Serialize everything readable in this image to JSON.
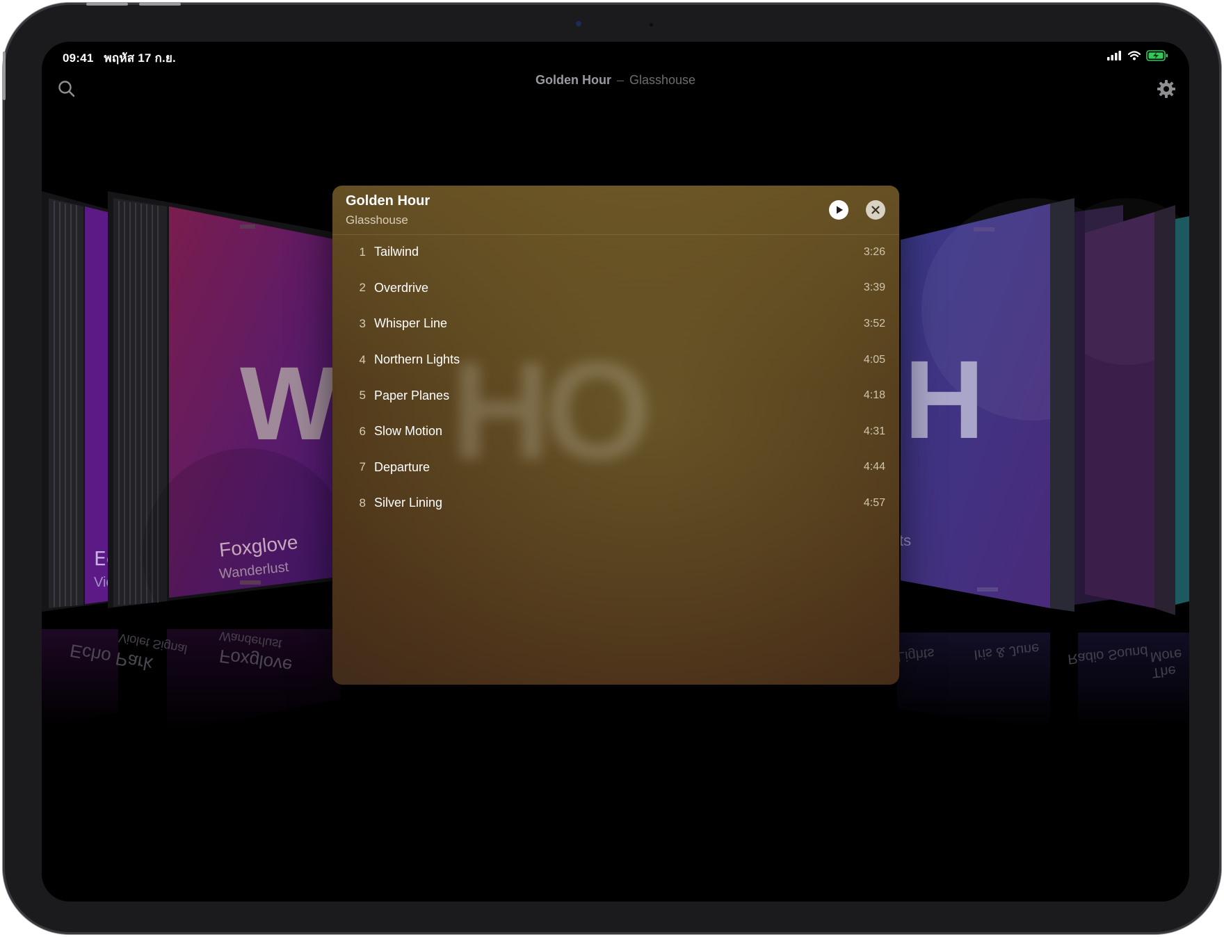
{
  "status_bar": {
    "time": "09:41",
    "date": "พฤหัส 17 ก.ย."
  },
  "topbar": {
    "album": "Golden Hour",
    "separator": "–",
    "artist": "Glasshouse"
  },
  "icons": {
    "search": "search-icon",
    "settings": "gear-icon",
    "play": "play-icon",
    "close": "close-icon"
  },
  "carousel": {
    "left": [
      {
        "title": "Echo Park",
        "subtitle": "Violet Signal",
        "visible_title": "Ec",
        "visible_subtitle": "Vio",
        "color": "#5b1a86"
      },
      {
        "title": "Foxglove",
        "subtitle": "Wanderlust",
        "big_letter": "W",
        "color": "#6c1d4d"
      }
    ],
    "right": [
      {
        "big_letter": "H",
        "visible_subtitle": "ts",
        "color": "#3d2f7a"
      },
      {
        "color": "#3b1e4a"
      },
      {
        "color": "#1d5a60"
      }
    ],
    "reflection_texts": [
      "Echo Park",
      "Violet Signal",
      "Foxglove",
      "Wanderlust",
      "Lights",
      "Iris & June",
      "Radio Sound",
      "The More"
    ]
  },
  "panel": {
    "title": "Golden Hour",
    "subtitle": "Glasshouse",
    "accent": "#5e4a22",
    "tracks": [
      {
        "number": "1",
        "name": "Tailwind",
        "duration": "3:26"
      },
      {
        "number": "2",
        "name": "Overdrive",
        "duration": "3:39"
      },
      {
        "number": "3",
        "name": "Whisper Line",
        "duration": "3:52"
      },
      {
        "number": "4",
        "name": "Northern Lights",
        "duration": "4:05"
      },
      {
        "number": "5",
        "name": "Paper Planes",
        "duration": "4:18"
      },
      {
        "number": "6",
        "name": "Slow Motion",
        "duration": "4:31"
      },
      {
        "number": "7",
        "name": "Departure",
        "duration": "4:44"
      },
      {
        "number": "8",
        "name": "Silver Lining",
        "duration": "4:57"
      }
    ]
  }
}
